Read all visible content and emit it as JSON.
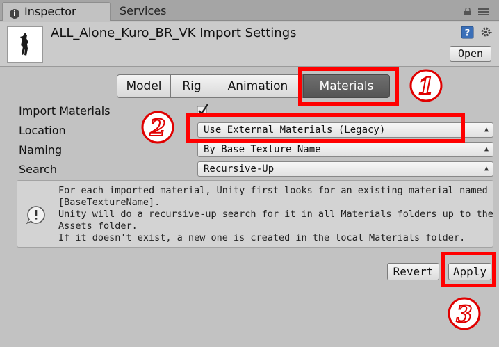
{
  "tabs": {
    "inspector": "Inspector",
    "services": "Services"
  },
  "icons": {
    "tab_info": "info-icon",
    "lock": "lock-icon",
    "menu": "menu-icon",
    "help": "help-icon",
    "settings": "gear-icon",
    "alert": "warning-icon"
  },
  "header": {
    "title": "ALL_Alone_Kuro_BR_VK Import Settings",
    "open_label": "Open"
  },
  "segmented": {
    "model": "Model",
    "rig": "Rig",
    "animation": "Animation",
    "materials": "Materials",
    "selected": "Materials"
  },
  "form": {
    "import_materials": {
      "label": "Import Materials",
      "checked": true
    },
    "location": {
      "label": "Location",
      "value": "Use External Materials (Legacy)"
    },
    "naming": {
      "label": "Naming",
      "value": "By Base Texture Name"
    },
    "search": {
      "label": "Search",
      "value": "Recursive-Up"
    }
  },
  "helpbox": {
    "lines": [
      "For each imported material, Unity first looks for an existing material named",
      "[BaseTextureName].",
      "Unity will do a recursive-up search for it in all Materials folders up to the",
      "Assets folder.",
      "If it doesn't exist, a new one is created in the local Materials folder."
    ]
  },
  "buttons": {
    "revert": "Revert",
    "apply": "Apply"
  },
  "annotations": {
    "step1": "1",
    "step2": "2",
    "step3": "3",
    "color": "#ff0000"
  }
}
